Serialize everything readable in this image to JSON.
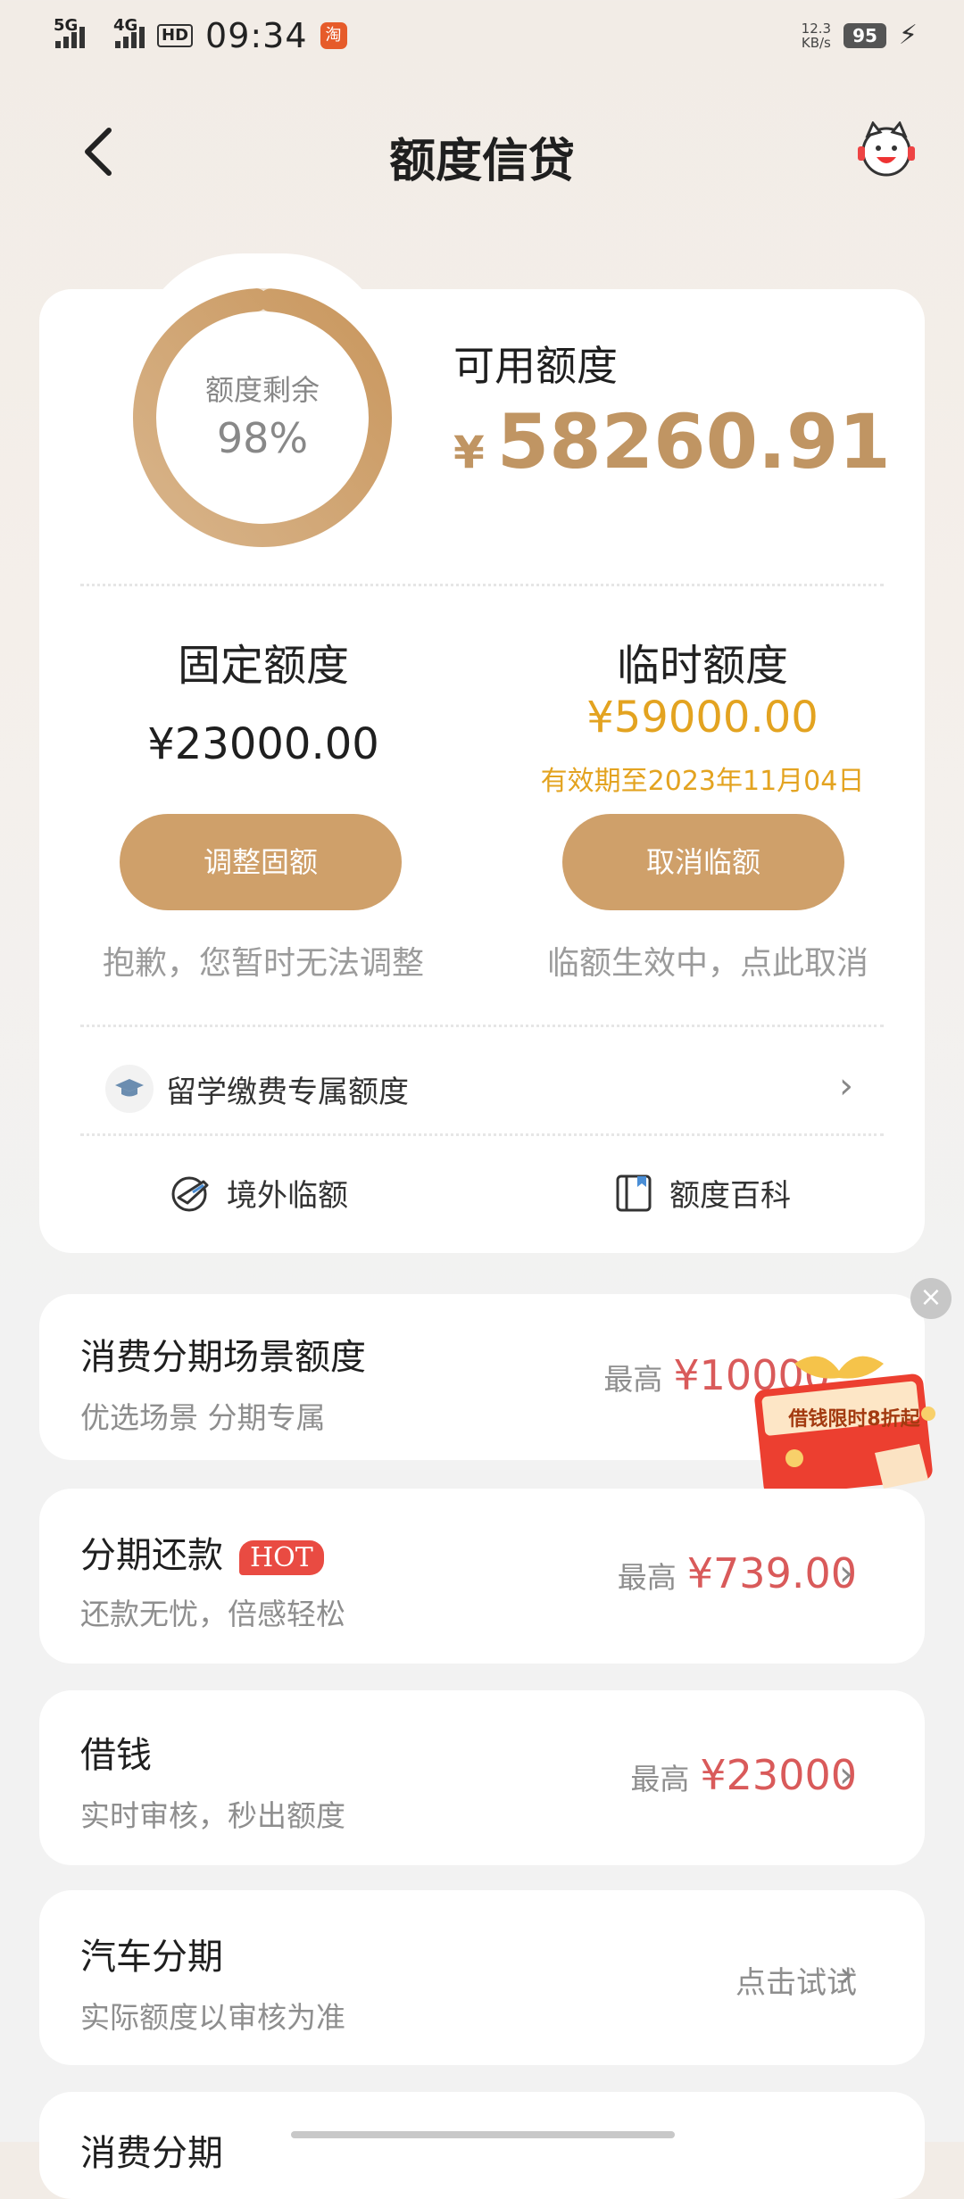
{
  "status": {
    "net1": "5G",
    "net2": "4G",
    "hd": "HD",
    "time": "09:34",
    "app_badge": "淘",
    "speed_value": "12.3",
    "speed_unit": "KB/s",
    "battery": "95"
  },
  "nav": {
    "back": "‹",
    "title": "额度信贷"
  },
  "summary": {
    "ring_label": "额度剩余",
    "ring_percent_text": "98%",
    "ring_fraction": 0.98,
    "available_label": "可用额度",
    "currency": "¥",
    "available_amount": "58260.91"
  },
  "fixed": {
    "label": "固定额度",
    "amount": "¥23000.00",
    "button": "调整固额",
    "hint": "抱歉，您暂时无法调整"
  },
  "temporary": {
    "label": "临时额度",
    "amount": "¥59000.00",
    "valid_until": "有效期至2023年11月04日",
    "button": "取消临额",
    "hint": "临额生效中，点此取消"
  },
  "study": {
    "label": "留学缴费专属额度"
  },
  "features": {
    "overseas": "境外临额",
    "wiki": "额度百科"
  },
  "rows": [
    {
      "title": "消费分期场景额度",
      "sub": "优选场景 分期专属",
      "prefix": "最高",
      "value": "¥10000"
    },
    {
      "title": "分期还款",
      "hot": "HOT",
      "sub": "还款无忧，倍感轻松",
      "prefix": "最高",
      "value": "¥739.00"
    },
    {
      "title": "借钱",
      "sub": "实时审核，秒出额度",
      "prefix": "最高",
      "value": "¥23000"
    },
    {
      "title": "汽车分期",
      "sub": "实际额度以审核为准",
      "action": "点击试试"
    },
    {
      "title": "消费分期"
    }
  ],
  "promo": {
    "text": "借钱限时8折起",
    "close": "×"
  },
  "colors": {
    "gold": "#c09563",
    "button": "#cfa06a",
    "temp_amber": "#e3a320",
    "red_value": "#d95a5a",
    "hot_badge": "#e94b42"
  }
}
